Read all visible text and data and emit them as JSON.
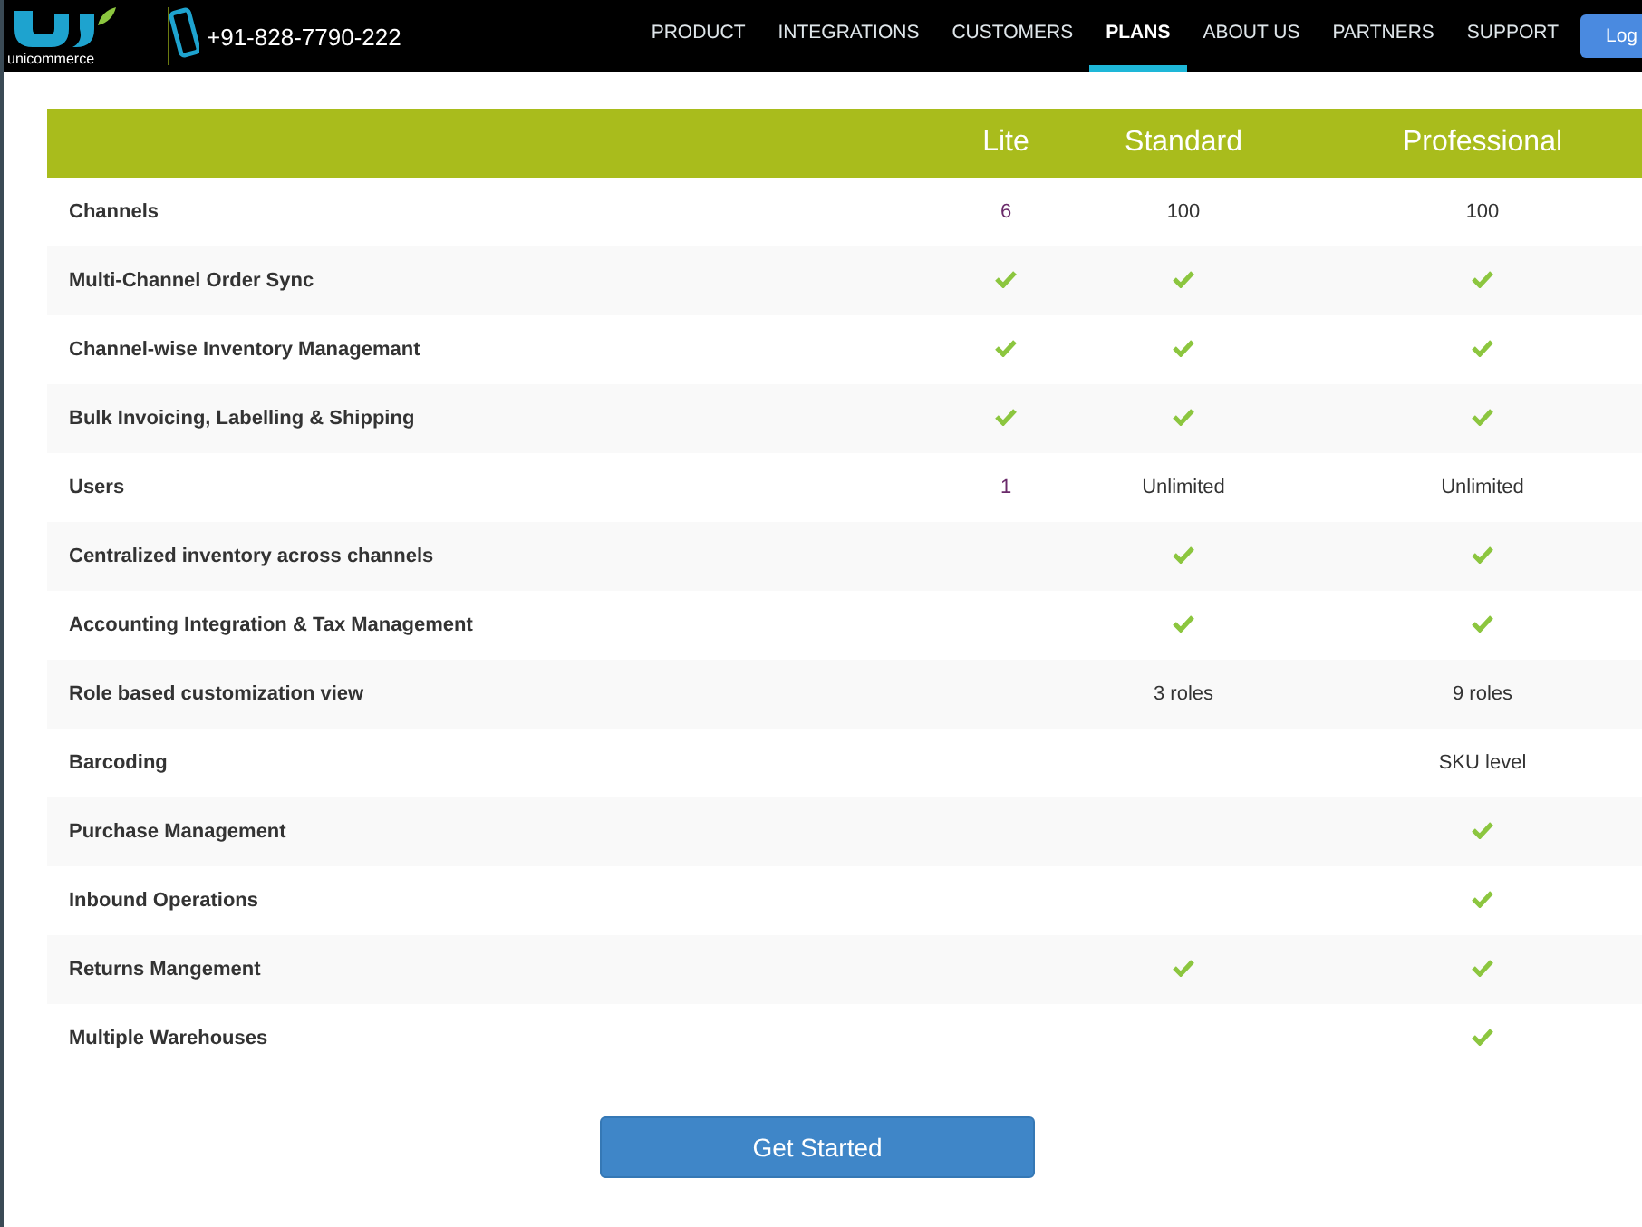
{
  "header": {
    "logo_text": "unicommerce",
    "phone": "+91-828-7790-222",
    "nav": [
      {
        "label": "PRODUCT",
        "selected": false
      },
      {
        "label": "INTEGRATIONS",
        "selected": false
      },
      {
        "label": "CUSTOMERS",
        "selected": false
      },
      {
        "label": "PLANS",
        "selected": true
      },
      {
        "label": "ABOUT US",
        "selected": false
      },
      {
        "label": "PARTNERS",
        "selected": false
      },
      {
        "label": "SUPPORT",
        "selected": false
      }
    ],
    "login_button": "Log"
  },
  "table": {
    "columns": [
      "Lite",
      "Standard",
      "Professional"
    ],
    "rows": [
      {
        "feature": "Channels",
        "cells": [
          {
            "kind": "text",
            "text": "6"
          },
          {
            "kind": "text",
            "text": "100"
          },
          {
            "kind": "text",
            "text": "100"
          }
        ]
      },
      {
        "feature": "Multi-Channel Order Sync",
        "cells": [
          {
            "kind": "check"
          },
          {
            "kind": "check"
          },
          {
            "kind": "check"
          }
        ]
      },
      {
        "feature": "Channel-wise Inventory Managemant",
        "cells": [
          {
            "kind": "check"
          },
          {
            "kind": "check"
          },
          {
            "kind": "check"
          }
        ]
      },
      {
        "feature": "Bulk Invoicing, Labelling & Shipping",
        "cells": [
          {
            "kind": "check"
          },
          {
            "kind": "check"
          },
          {
            "kind": "check"
          }
        ]
      },
      {
        "feature": "Users",
        "cells": [
          {
            "kind": "text",
            "text": "1"
          },
          {
            "kind": "text",
            "text": "Unlimited"
          },
          {
            "kind": "text",
            "text": "Unlimited"
          }
        ]
      },
      {
        "feature": "Centralized inventory across channels",
        "cells": [
          {
            "kind": "blank"
          },
          {
            "kind": "check"
          },
          {
            "kind": "check"
          }
        ]
      },
      {
        "feature": "Accounting Integration & Tax Management",
        "cells": [
          {
            "kind": "blank"
          },
          {
            "kind": "check"
          },
          {
            "kind": "check"
          }
        ]
      },
      {
        "feature": "Role based customization view",
        "cells": [
          {
            "kind": "blank"
          },
          {
            "kind": "text",
            "text": "3 roles"
          },
          {
            "kind": "text",
            "text": "9 roles"
          }
        ]
      },
      {
        "feature": "Barcoding",
        "cells": [
          {
            "kind": "blank"
          },
          {
            "kind": "blank"
          },
          {
            "kind": "text",
            "text": "SKU level"
          }
        ]
      },
      {
        "feature": "Purchase Management",
        "cells": [
          {
            "kind": "blank"
          },
          {
            "kind": "blank"
          },
          {
            "kind": "check"
          }
        ]
      },
      {
        "feature": "Inbound Operations",
        "cells": [
          {
            "kind": "blank"
          },
          {
            "kind": "blank"
          },
          {
            "kind": "check"
          }
        ]
      },
      {
        "feature": "Returns Mangement",
        "cells": [
          {
            "kind": "blank"
          },
          {
            "kind": "check"
          },
          {
            "kind": "check"
          }
        ]
      },
      {
        "feature": "Multiple Warehouses",
        "cells": [
          {
            "kind": "blank"
          },
          {
            "kind": "blank"
          },
          {
            "kind": "check"
          }
        ]
      }
    ]
  },
  "cta_button": "Get Started"
}
